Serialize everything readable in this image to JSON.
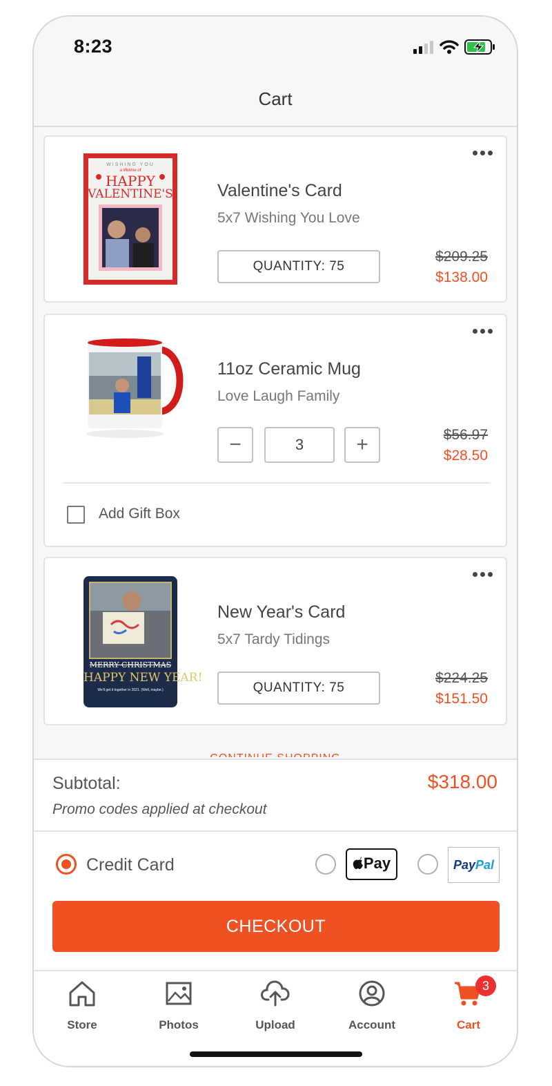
{
  "status_bar": {
    "time": "8:23"
  },
  "header": {
    "title": "Cart"
  },
  "items": [
    {
      "name": "Valentine's Card",
      "description": "5x7 Wishing You Love",
      "quantity_label": "QUANTITY: 75",
      "original_price": "$209.25",
      "price": "$138.00",
      "thumb_text": {
        "top": "WISHING YOU",
        "script": "a lifetime of",
        "main1": "HAPPY",
        "main2": "VALENTINE'S"
      }
    },
    {
      "name": "11oz Ceramic Mug",
      "description": "Love Laugh Family",
      "quantity": "3",
      "minus": "−",
      "plus": "+",
      "original_price": "$56.97",
      "price": "$28.50",
      "gift_box_label": "Add Gift Box"
    },
    {
      "name": "New Year's Card",
      "description": "5x7 Tardy Tidings",
      "quantity_label": "QUANTITY: 75",
      "original_price": "$224.25",
      "price": "$151.50",
      "thumb_text": {
        "line1": "MERRY CHRISTMAS",
        "line2": "HAPPY NEW YEAR!",
        "line3": "We'll get it together in 2021. (Well, maybe.)"
      }
    }
  ],
  "continue_shopping": "CONTINUE SHOPPING",
  "summary": {
    "subtotal_label": "Subtotal:",
    "subtotal_value": "$318.00",
    "promo_note": "Promo codes applied at checkout",
    "payment": {
      "credit_card_label": "Credit Card",
      "apple_pay_label": "Pay",
      "paypal_a": "Pay",
      "paypal_b": "Pal",
      "selected": "Credit Card"
    },
    "checkout_label": "CHECKOUT"
  },
  "tabbar": {
    "tabs": [
      {
        "label": "Store",
        "icon": "home-icon"
      },
      {
        "label": "Photos",
        "icon": "image-icon"
      },
      {
        "label": "Upload",
        "icon": "cloud-upload-icon"
      },
      {
        "label": "Account",
        "icon": "account-icon"
      },
      {
        "label": "Cart",
        "icon": "cart-icon",
        "badge": "3",
        "active": true
      }
    ]
  },
  "colors": {
    "accent": "#ee5122",
    "badge": "#ee2f2f"
  }
}
